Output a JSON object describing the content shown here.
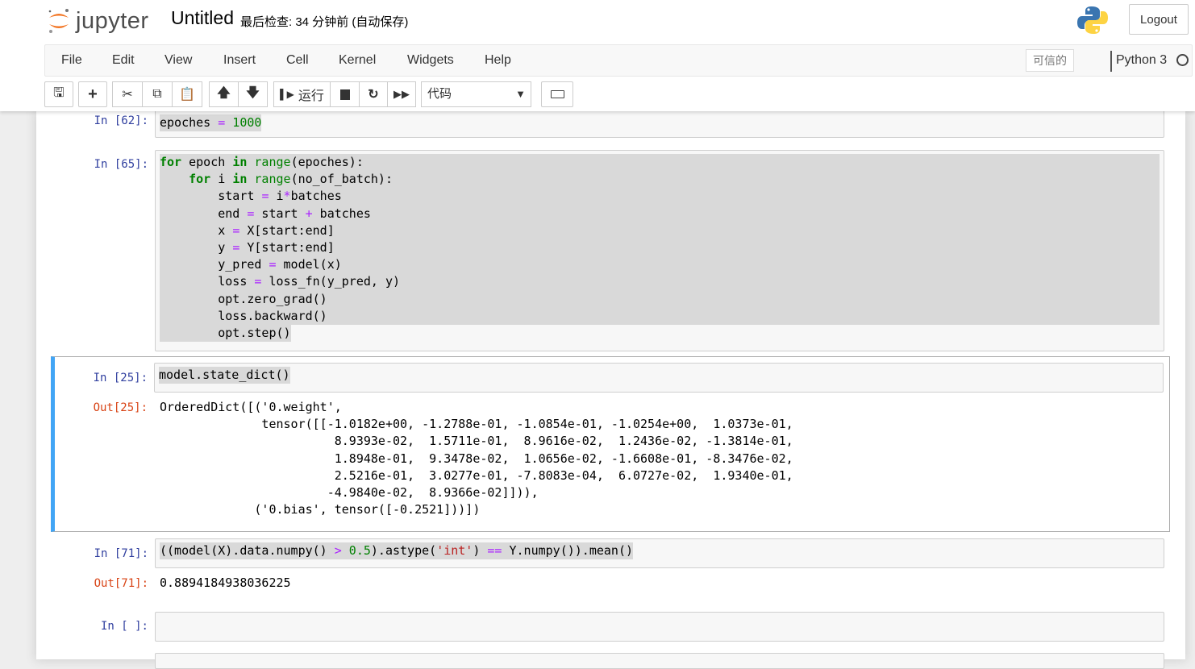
{
  "header": {
    "logo_text": "jupyter",
    "notebook_name": "Untitled",
    "checkpoint": "最后检查: 34 分钟前  (自动保存)",
    "logout_label": "Logout"
  },
  "menubar": {
    "items": [
      "File",
      "Edit",
      "View",
      "Insert",
      "Cell",
      "Kernel",
      "Widgets",
      "Help"
    ],
    "trusted": "可信的",
    "kernel_name": "Python 3"
  },
  "toolbar": {
    "run_label": "运行",
    "cell_type": "代码"
  },
  "cells": [
    {
      "prompt": "In  [62]:",
      "code": [
        [
          [
            "",
            "epoches "
          ],
          [
            "o",
            "="
          ],
          [
            "n",
            " 1000"
          ]
        ]
      ]
    },
    {
      "prompt": "In  [65]:",
      "code": [
        [
          [
            "k",
            "for"
          ],
          [
            "",
            " epoch "
          ],
          [
            "k",
            "in"
          ],
          [
            "b",
            " range"
          ],
          [
            "",
            "(epoches):"
          ]
        ],
        [
          [
            "",
            "    "
          ],
          [
            "k",
            "for"
          ],
          [
            "",
            " i "
          ],
          [
            "k",
            "in"
          ],
          [
            "b",
            " range"
          ],
          [
            "",
            "(no_of_batch):"
          ]
        ],
        [
          [
            "",
            "        start "
          ],
          [
            "o",
            "="
          ],
          [
            "",
            " i"
          ],
          [
            "o",
            "*"
          ],
          [
            "",
            "batches"
          ]
        ],
        [
          [
            "",
            "        end "
          ],
          [
            "o",
            "="
          ],
          [
            "",
            " start "
          ],
          [
            "o",
            "+"
          ],
          [
            "",
            " batches"
          ]
        ],
        [
          [
            "",
            "        x "
          ],
          [
            "o",
            "="
          ],
          [
            "",
            " X[start:end]"
          ]
        ],
        [
          [
            "",
            "        y "
          ],
          [
            "o",
            "="
          ],
          [
            "",
            " Y[start:end]"
          ]
        ],
        [
          [
            "",
            "        y_pred "
          ],
          [
            "o",
            "="
          ],
          [
            "",
            " model(x)"
          ]
        ],
        [
          [
            "",
            "        loss "
          ],
          [
            "o",
            "="
          ],
          [
            "",
            " loss_fn(y_pred, y)"
          ]
        ],
        [
          [
            "",
            "        opt.zero_grad()"
          ]
        ],
        [
          [
            "",
            "        loss.backward()"
          ]
        ],
        [
          [
            "",
            "        opt.step()"
          ]
        ]
      ]
    },
    {
      "prompt": "In  [25]:",
      "out_prompt": "Out[25]:",
      "code": [
        [
          [
            "",
            "model.state_dict()"
          ]
        ]
      ],
      "output": "OrderedDict([('0.weight',\n              tensor([[-1.0182e+00, -1.2788e-01, -1.0854e-01, -1.0254e+00,  1.0373e-01,\n                        8.9393e-02,  1.5711e-01,  8.9616e-02,  1.2436e-02, -1.3814e-01,\n                        1.8948e-01,  9.3478e-02,  1.0656e-02, -1.6608e-01, -8.3476e-02,\n                        2.5216e-01,  3.0277e-01, -7.8083e-04,  6.0727e-02,  1.9340e-01,\n                       -4.9840e-02,  8.9366e-02]])),\n             ('0.bias', tensor([-0.2521]))])"
    },
    {
      "prompt": "In  [71]:",
      "out_prompt": "Out[71]:",
      "code": [
        [
          [
            "",
            "((model(X).data.numpy() "
          ],
          [
            "o",
            ">"
          ],
          [
            "n",
            " 0.5"
          ],
          [
            "",
            ").astype("
          ],
          [
            "s",
            "'int'"
          ],
          [
            "",
            ") "
          ],
          [
            "o",
            "=="
          ],
          [
            "",
            " Y.numpy()).mean()"
          ]
        ]
      ],
      "output": "0.8894184938036225"
    },
    {
      "prompt": "In  [ ]:",
      "code": []
    }
  ]
}
